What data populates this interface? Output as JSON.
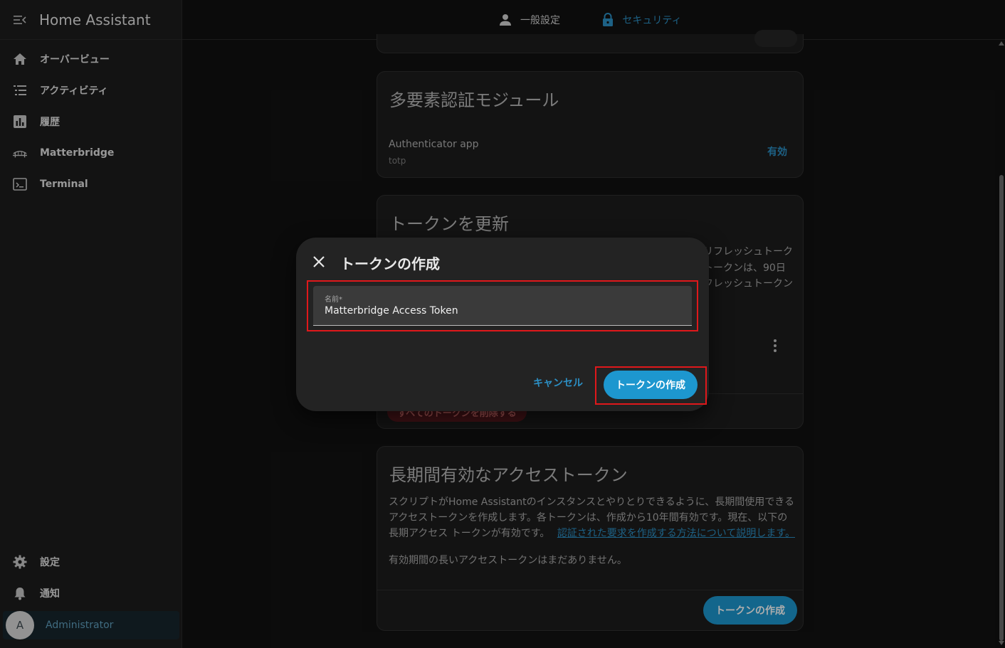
{
  "app": {
    "title": "Home Assistant"
  },
  "sidebar": {
    "items": [
      {
        "label": "オーバービュー",
        "icon": "home-icon"
      },
      {
        "label": "アクティビティ",
        "icon": "list-icon"
      },
      {
        "label": "履歴",
        "icon": "chart-box-icon"
      },
      {
        "label": "Matterbridge",
        "icon": "bridge-icon"
      },
      {
        "label": "Terminal",
        "icon": "console-icon"
      }
    ],
    "bottom_items": [
      {
        "label": "設定",
        "icon": "gear-icon"
      },
      {
        "label": "通知",
        "icon": "bell-icon"
      }
    ],
    "user": {
      "initial": "A",
      "name": "Administrator"
    }
  },
  "tabs": [
    {
      "label": "一般設定",
      "icon": "account-icon"
    },
    {
      "label": "セキュリティ",
      "icon": "lock-icon"
    }
  ],
  "mfa": {
    "title": "多要素認証モジュール",
    "module_name": "Authenticator app",
    "module_id": "totp",
    "status": "有効"
  },
  "refresh": {
    "title": "トークンを更新",
    "desc_lines": [
      "リフレッシュトーク",
      "トークンは、90日",
      "フレッシュトークン"
    ],
    "delete_all_label": "すべてのトークンを削除する"
  },
  "longlived": {
    "title": "長期間有効なアクセストークン",
    "desc_line1": "スクリプトがHome Assistantのインスタンスとやりとりできるように、長期間使用できる",
    "desc_line2": "アクセストークンを作成します。各トークンは、作成から10年間有効です。現在、以下の",
    "desc_line3": "長期アクセス トークンが有効です。",
    "link": "認証された要求を作成する方法について説明します。",
    "empty": "有効期間の長いアクセストークンはまだありません。",
    "create_button": "トークンの作成"
  },
  "dialog": {
    "title": "トークンの作成",
    "field_label": "名前*",
    "field_value": "Matterbridge Access Token",
    "cancel": "キャンセル",
    "create": "トークンの作成"
  },
  "colors": {
    "accent": "#2c8fc4",
    "primary_button": "#1d97cf",
    "highlight": "#e0181b"
  }
}
